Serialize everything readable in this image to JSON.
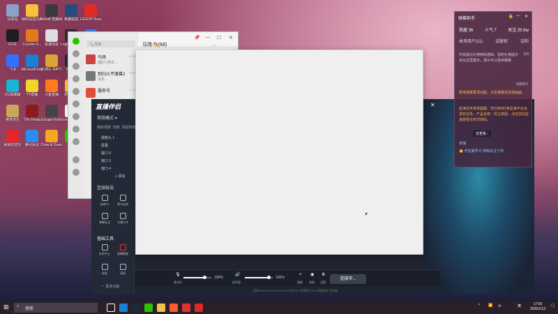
{
  "desktop": {
    "icons": [
      {
        "label": "回收站",
        "color": "#8aa2c8"
      },
      {
        "label": "我的信息同步",
        "color": "#f6c23a"
      },
      {
        "label": "dcbqtf 连接网络",
        "color": "#3a3a3a"
      },
      {
        "label": "英雄联盟",
        "color": "#274b7d"
      },
      {
        "label": "LEGO® Voyages",
        "color": "#e02b2b"
      },
      {
        "label": "ICUE",
        "color": "#1e1e1e"
      },
      {
        "label": "Counter-S...",
        "color": "#e07a1a"
      },
      {
        "label": "极速体验",
        "color": "#ddd"
      },
      {
        "label": "Logitech G HUB",
        "color": "#2b2b2b"
      },
      {
        "label": "MuMu模拟器12",
        "color": "#2b7de9"
      },
      {
        "label": "飞书",
        "color": "#3370ff"
      },
      {
        "label": "Microsoft Edge",
        "color": "#1b7fd6"
      },
      {
        "label": "PUBG: BATTLEGR...",
        "color": "#d7a634"
      },
      {
        "label": "Steam",
        "color": "#1b2838"
      },
      {
        "label": "YY语音",
        "color": "#f5c518"
      },
      {
        "label": "UU加速器",
        "color": "#19b4d3"
      },
      {
        "label": "YY直播",
        "color": "#f2d52b"
      },
      {
        "label": "斗鱼直播",
        "color": "#ff7a1a"
      },
      {
        "label": "虎牙直播",
        "color": "#f7b731"
      },
      {
        "label": "新建文本文档",
        "color": "#f2f2f2"
      },
      {
        "label": "绝地求生",
        "color": "#c9a85a"
      },
      {
        "label": "The Finals",
        "color": "#8a1c1c"
      },
      {
        "label": "Escape from Tarkov",
        "color": "#444"
      },
      {
        "label": "Goose Goose Duck",
        "color": "#f2f2f2"
      },
      {
        "label": "Dead by Daylight",
        "color": "#6b1e1e"
      },
      {
        "label": "网易云音乐",
        "color": "#e32626"
      },
      {
        "label": "腾讯会议",
        "color": "#2d8cf0"
      },
      {
        "label": "Draw & Guess",
        "color": "#f5a623"
      },
      {
        "label": "微信",
        "color": "#2dc100"
      },
      {
        "label": "QQ音乐",
        "color": "#f9d21c"
      }
    ]
  },
  "chat_window": {
    "search_placeholder": "搜索",
    "header_title": "马场🐴(68)",
    "controls": {
      "pin": "📌",
      "minimize": "—",
      "maximize": "☐",
      "close": "✕",
      "more": "···"
    },
    "items": [
      {
        "name": "马场",
        "sub": "[图片] 新年...",
        "time": "17:55",
        "color": "#c44"
      },
      {
        "name": "到归火不落幕2",
        "sub": "消息...",
        "time": "17:50",
        "color": "#777"
      },
      {
        "name": "服务号",
        "sub": "",
        "time": "17:45",
        "color": "#e04e3a"
      }
    ]
  },
  "stream_app": {
    "logo": "直播伴侣",
    "mode": "常规横式 ▾",
    "tabs": [
      "我的场景",
      "场景",
      "添加场景"
    ],
    "scene_items": [
      "摄像头 1",
      "屏幕",
      "窗口 6",
      "窗口 5",
      "窗口 4"
    ],
    "add_label": "+ 添加",
    "section_interact": "互动玩法",
    "section_tools": "基础工具",
    "interact_tools": [
      "连线PK",
      "观众连线",
      "弹幕玩法",
      "主播口令"
    ],
    "basic_tools": [
      "任务中心",
      "直播数据",
      "直播预告",
      "活动",
      "贴纸",
      "录屏",
      "投屏",
      "下载剪辑"
    ],
    "more_label": "一 更多功能",
    "volume_mic": "230%",
    "volume_speaker": "100%",
    "volume_mic_fraction": 0.75,
    "volume_speaker_fraction": 0.85,
    "mic_label": "麦克风",
    "speaker_label": "扬声器",
    "beauty_label": "美颜",
    "record_label": "录制",
    "settings_label": "设置",
    "start_button": "连接中...",
    "status_text": "码率0Kb/s   FPS:60   CPU 2%   内存28%   丢帧率0.00%   网络良好   分析器"
  },
  "danmaku_panel": {
    "title": "弹幕助手",
    "stats": [
      "热度 36",
      "人气 7",
      "关注 25.5w"
    ],
    "tabs": [
      "本场用户(11)",
      "话联权",
      "话和"
    ],
    "notice": "开启提示礼物特效通知，您的礼物提示会在这里展示，观众可以看到弹幕",
    "gift_count": "0.0",
    "viewers_label": "0点对人",
    "highlight_1": "新增弹幕置顶功能，点击弹幕添加进画面",
    "highlight_2": "星海任务排单提醒：您已收到1条星海平台派发的任务，产品名称：风之旅团，点击前往星海查看任务详情吗。",
    "view_button": "去查看 ›",
    "user_name": "朱槐",
    "follow_msg": "🌟 开狂暴学习 阿晖关注了你",
    "colors": {
      "highlight": "#ffb347",
      "accent": "#7ad0ff"
    }
  },
  "taskbar": {
    "search_placeholder": "搜索",
    "time": "17:55",
    "date": "2026/1/12",
    "lang": "英",
    "apps": [
      {
        "name": "task-view",
        "color": "#ffffff"
      },
      {
        "name": "edge",
        "color": "#1b7fd6"
      },
      {
        "name": "steam",
        "color": "#1b2838"
      },
      {
        "name": "wechat",
        "color": "#2dc100"
      },
      {
        "name": "explorer",
        "color": "#f2c14e"
      },
      {
        "name": "app1",
        "color": "#ff5b33"
      },
      {
        "name": "app2",
        "color": "#d33"
      },
      {
        "name": "netease-music",
        "color": "#e32626"
      }
    ]
  }
}
